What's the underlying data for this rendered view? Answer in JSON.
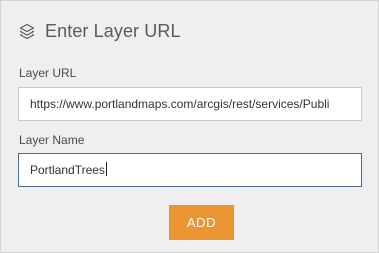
{
  "dialog": {
    "title": "Enter Layer URL",
    "header_icon": "layers-icon"
  },
  "form": {
    "layer_url": {
      "label": "Layer URL",
      "value": "https://www.portlandmaps.com/arcgis/rest/services/Publi"
    },
    "layer_name": {
      "label": "Layer Name",
      "value": "PortlandTrees"
    },
    "add_button_label": "ADD"
  },
  "colors": {
    "accent": "#EA9432",
    "focus_border": "#4A6D8C",
    "panel_background": "#EFEFEF"
  }
}
